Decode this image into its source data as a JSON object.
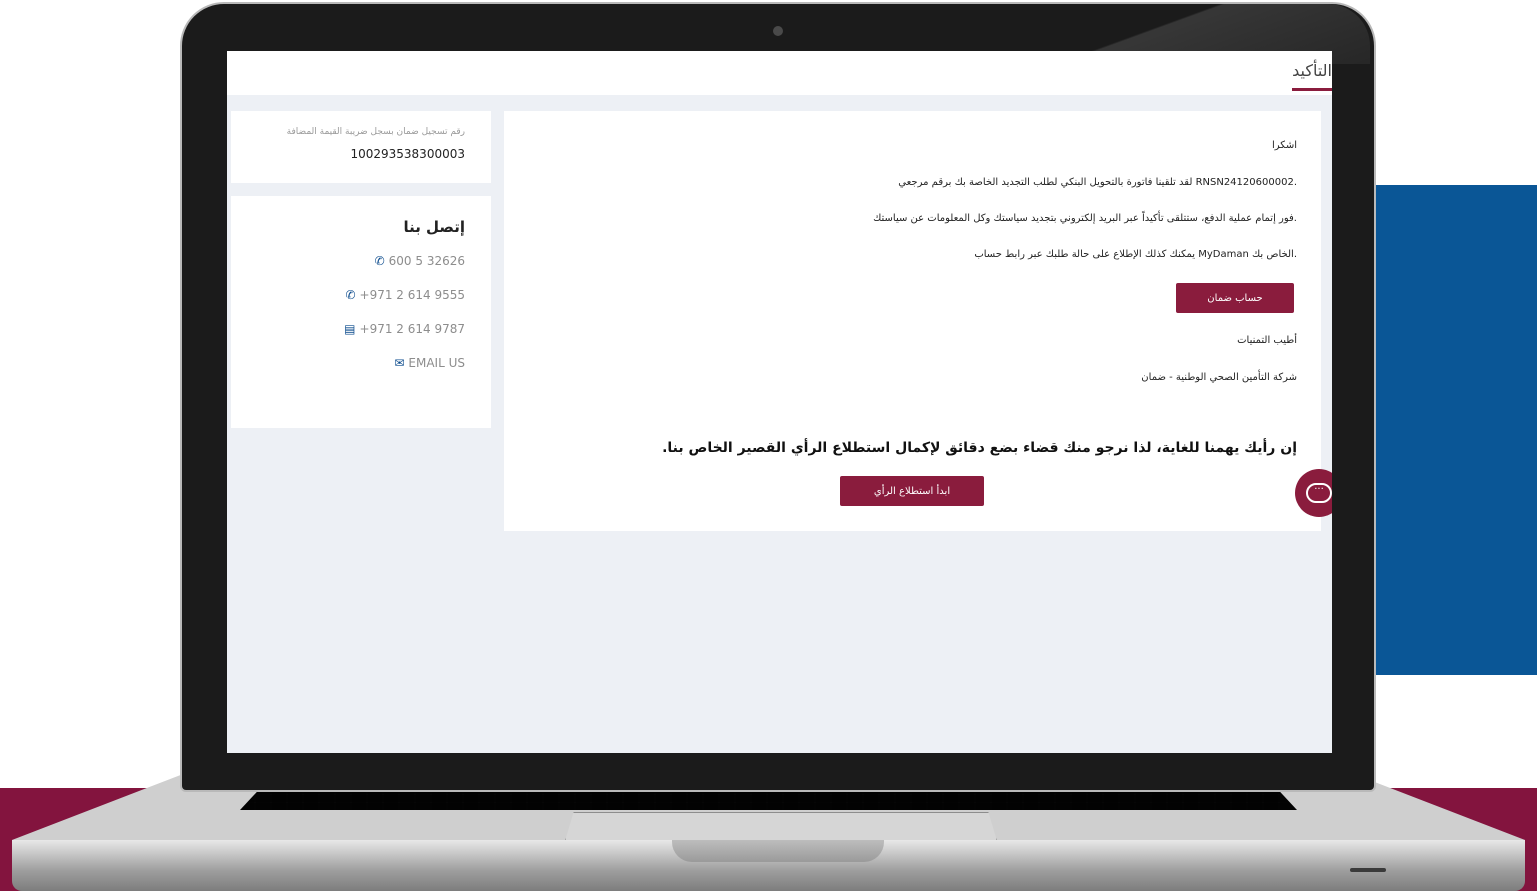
{
  "page": {
    "tab_label": "التأكيد"
  },
  "registration": {
    "label": "رقم تسجيل ضمان بسجل ضريبة القيمة المضافة",
    "value": "100293538300003"
  },
  "contact": {
    "title": "إتصل بنا",
    "phone1": "600 5 32626",
    "phone2": "+971 2 614 9555",
    "fax": "+971 2 614 9787",
    "email": "EMAIL US"
  },
  "main": {
    "thanks": "اشكرا",
    "line1": ".RNSN24120600002 لقد تلقينا فاتورة بالتحويل البنكي لطلب التجديد الخاصة بك برقم مرجعي",
    "line2": ".فور إتمام عملية الدفع، ستتلقى تأكيداً عبر البريد إلكتروني بتجديد سياستك وكل المعلومات عن سياستك",
    "line3": ".الخاص بك MyDaman يمكنك كذلك الإطلاع على حالة طلبك عبر رابط حساب",
    "account_button": "حساب ضمان",
    "regards": "أطيب التمنيات",
    "company": "شركة التأمين الصحي الوطنية - ضمان",
    "survey_heading": "إن رأيك يهمنا للغاية، لذا نرجو منك قضاء بضع دقائق لإكمال استطلاع الرأي القصير الخاص بنا.",
    "survey_button": "ابدأ استطلاع الرأي"
  },
  "chat": {
    "icon": "chat-icon",
    "glyph": "···"
  },
  "colors": {
    "maroon": "#8a1c3d",
    "blue": "#0a5696",
    "band": "#83143e"
  }
}
